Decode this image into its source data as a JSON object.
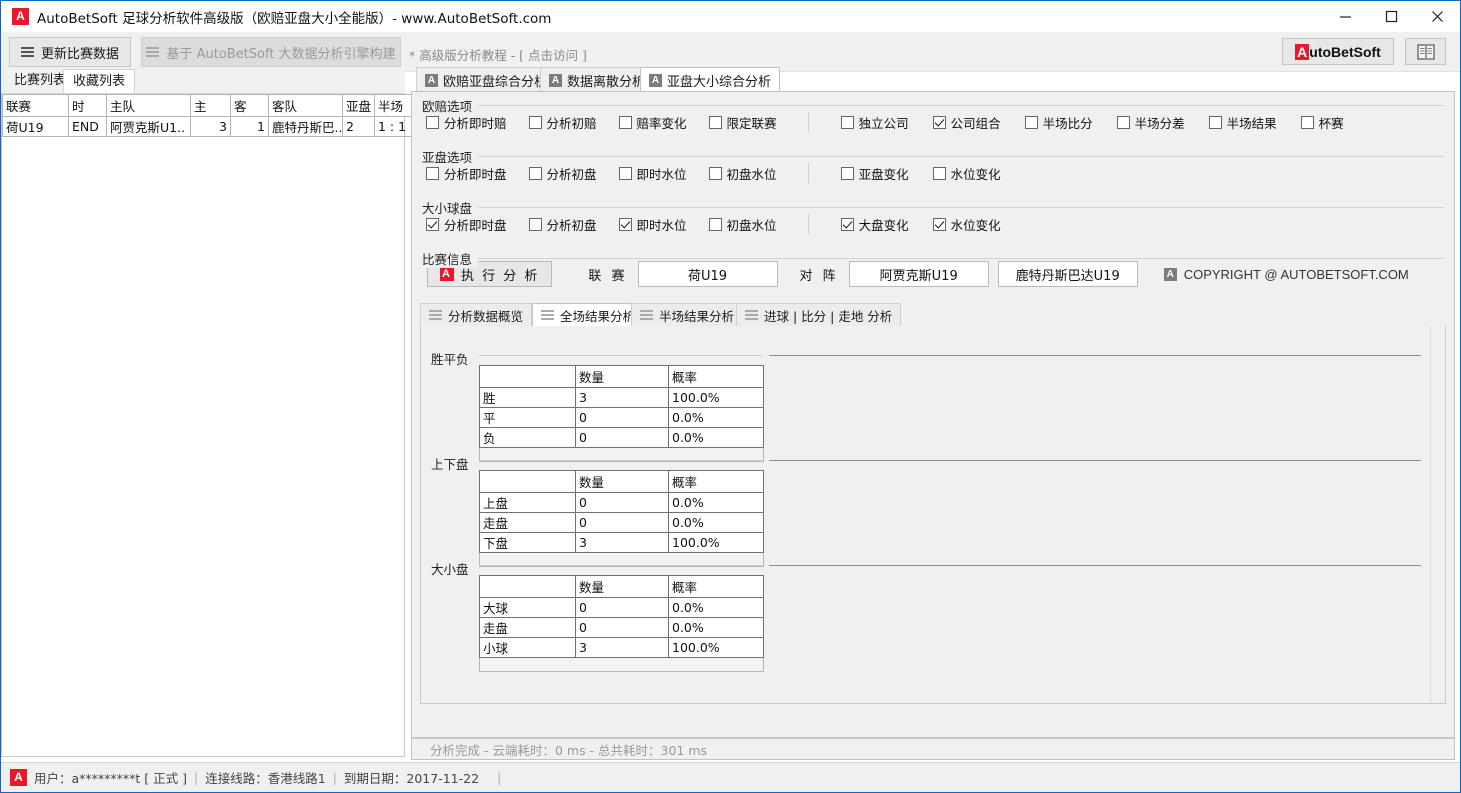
{
  "window": {
    "title": "AutoBetSoft 足球分析软件高级版（欧赔亚盘大小全能版）-  www.AutoBetSoft.com",
    "app_icon": "A",
    "minimize": "minimize-icon",
    "maximize": "maximize-icon",
    "close": "close-icon"
  },
  "toolbar": {
    "update_button": "更新比赛数据",
    "engine_button": "基于 AutoBetSoft 大数据分析引擎构建",
    "tutorial_link": "* 高级版分析教程 - [ 点击访问 ]",
    "brand_button_red": "A",
    "brand_button_rest": "utoBetSoft",
    "book_icon": "book-icon"
  },
  "left": {
    "tabs": [
      {
        "label": "比赛列表",
        "active": false
      },
      {
        "label": "收藏列表",
        "active": true
      }
    ],
    "table": {
      "headers": [
        "联赛",
        "时",
        "主队",
        "主",
        "客",
        "客队",
        "亚盘",
        "半场"
      ],
      "rows": [
        {
          "league": "荷U19",
          "time": "END",
          "home": "阿贾克斯U1..",
          "home_score": "3",
          "away_score": "1",
          "away": "鹿特丹斯巴...",
          "handicap": "2",
          "half": "1 : 1"
        }
      ]
    }
  },
  "right": {
    "tabs": [
      {
        "badge": "A",
        "label": "欧赔亚盘综合分析",
        "active": false
      },
      {
        "badge": "A",
        "label": "数据离散分析",
        "active": false
      },
      {
        "badge": "A",
        "label": "亚盘大小综合分析",
        "active": true
      }
    ],
    "groups": [
      {
        "title": "欧赔选项",
        "left_options": [
          {
            "label": "分析即时赔",
            "checked": false
          },
          {
            "label": "分析初赔",
            "checked": false
          },
          {
            "label": "赔率变化",
            "checked": false
          },
          {
            "label": "限定联赛",
            "checked": false
          }
        ],
        "right_options": [
          {
            "label": "独立公司",
            "checked": false
          },
          {
            "label": "公司组合",
            "checked": true
          },
          {
            "label": "半场比分",
            "checked": false
          },
          {
            "label": "半场分差",
            "checked": false
          },
          {
            "label": "半场结果",
            "checked": false
          },
          {
            "label": "杯赛",
            "checked": false
          }
        ]
      },
      {
        "title": "亚盘选项",
        "left_options": [
          {
            "label": "分析即时盘",
            "checked": false
          },
          {
            "label": "分析初盘",
            "checked": false
          },
          {
            "label": "即时水位",
            "checked": false
          },
          {
            "label": "初盘水位",
            "checked": false
          }
        ],
        "right_options": [
          {
            "label": "亚盘变化",
            "checked": false
          },
          {
            "label": "水位变化",
            "checked": false
          }
        ]
      },
      {
        "title": "大小球盘",
        "left_options": [
          {
            "label": "分析即时盘",
            "checked": true
          },
          {
            "label": "分析初盘",
            "checked": false
          },
          {
            "label": "即时水位",
            "checked": true
          },
          {
            "label": "初盘水位",
            "checked": false
          }
        ],
        "right_options": [
          {
            "label": "大盘变化",
            "checked": true
          },
          {
            "label": "水位变化",
            "checked": true
          }
        ]
      }
    ],
    "match_info": {
      "title": "比赛信息",
      "exec_button": "执 行 分 析",
      "exec_badge": "A",
      "league_label": "联 赛",
      "league_value": "荷U19",
      "versus_label": "对 阵",
      "home_value": "阿贾克斯U19",
      "away_value": "鹿特丹斯巴达U19",
      "copyright_badge": "A",
      "copyright": "COPYRIGHT @ AUTOBETSOFT.COM"
    },
    "sub_tabs": [
      {
        "label": "分析数据概览",
        "active": false
      },
      {
        "label": "全场结果分析",
        "active": true
      },
      {
        "label": "半场结果分析",
        "active": false
      },
      {
        "label": "进球 | 比分 | 走地 分析",
        "active": false
      }
    ],
    "status": "分析完成 -  云端耗时：0 ms  - 总共耗时：301 ms"
  },
  "chart_data": [
    {
      "type": "table",
      "title": "胜平负",
      "columns": [
        "",
        "数量",
        "概率"
      ],
      "rows": [
        [
          "胜",
          "3",
          "100.0%"
        ],
        [
          "平",
          "0",
          "0.0%"
        ],
        [
          "负",
          "0",
          "0.0%"
        ]
      ]
    },
    {
      "type": "table",
      "title": "上下盘",
      "columns": [
        "",
        "数量",
        "概率"
      ],
      "rows": [
        [
          "上盘",
          "0",
          "0.0%"
        ],
        [
          "走盘",
          "0",
          "0.0%"
        ],
        [
          "下盘",
          "3",
          "100.0%"
        ]
      ]
    },
    {
      "type": "table",
      "title": "大小盘",
      "columns": [
        "",
        "数量",
        "概率"
      ],
      "rows": [
        [
          "大球",
          "0",
          "0.0%"
        ],
        [
          "走盘",
          "0",
          "0.0%"
        ],
        [
          "小球",
          "3",
          "100.0%"
        ]
      ]
    }
  ],
  "statusbar": {
    "badge": "A",
    "user": "用户：a*********t [ 正式 ]",
    "sep1": "|",
    "line": "连接线路：香港线路1",
    "sep2": "|",
    "expiry": "到期日期：2017-11-22",
    "sep3": "|"
  },
  "colors": {
    "accent_red": "#e8172a",
    "window_border": "#0a69c8",
    "panel_bg": "#f0f0f0"
  }
}
